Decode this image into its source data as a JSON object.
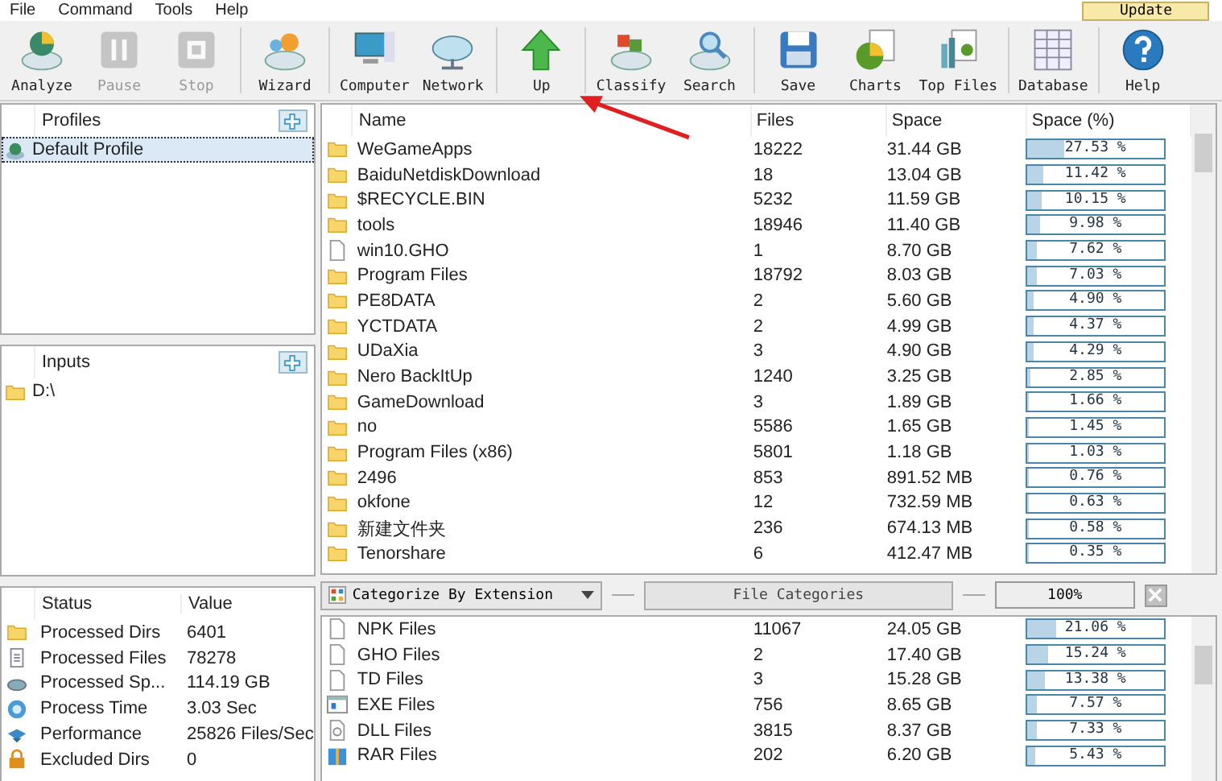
{
  "menu": [
    "File",
    "Command",
    "Tools",
    "Help"
  ],
  "update_button": "Update",
  "toolbar": [
    [
      {
        "label": "Analyze",
        "disabled": false
      },
      {
        "label": "Pause",
        "disabled": true
      },
      {
        "label": "Stop",
        "disabled": true
      }
    ],
    [
      {
        "label": "Wizard",
        "disabled": false
      }
    ],
    [
      {
        "label": "Computer",
        "disabled": false
      },
      {
        "label": "Network",
        "disabled": false
      }
    ],
    [
      {
        "label": "Up",
        "disabled": false
      }
    ],
    [
      {
        "label": "Classify",
        "disabled": false
      },
      {
        "label": "Search",
        "disabled": false
      }
    ],
    [
      {
        "label": "Save",
        "disabled": false
      },
      {
        "label": "Charts",
        "disabled": false
      },
      {
        "label": "Top Files",
        "disabled": false
      }
    ],
    [
      {
        "label": "Database",
        "disabled": false
      }
    ],
    [
      {
        "label": "Help",
        "disabled": false
      }
    ]
  ],
  "profiles": {
    "title": "Profiles",
    "items": [
      {
        "label": "Default Profile",
        "selected": true
      }
    ]
  },
  "inputs": {
    "title": "Inputs",
    "items": [
      {
        "label": "D:\\",
        "selected": false
      }
    ]
  },
  "status": {
    "columns": [
      "Status",
      "Value"
    ],
    "rows": [
      {
        "label": "Processed Dirs",
        "value": "6401"
      },
      {
        "label": "Processed Files",
        "value": "78278"
      },
      {
        "label": "Processed Sp...",
        "value": "114.19 GB"
      },
      {
        "label": "Process Time",
        "value": "3.03 Sec"
      },
      {
        "label": "Performance",
        "value": "25826 Files/Sec"
      },
      {
        "label": "Excluded Dirs",
        "value": "0"
      }
    ]
  },
  "table": {
    "columns": [
      "Name",
      "Files",
      "Space",
      "Space (%)"
    ],
    "rows": [
      {
        "kind": "folder",
        "name": "WeGameApps",
        "files": "18222",
        "space": "31.44 GB",
        "percent": "27.53 %",
        "level": 0.2753
      },
      {
        "kind": "folder",
        "name": "BaiduNetdiskDownload",
        "files": "18",
        "space": "13.04 GB",
        "percent": "11.42 %",
        "level": 0.1142
      },
      {
        "kind": "folder",
        "name": "$RECYCLE.BIN",
        "files": "5232",
        "space": "11.59 GB",
        "percent": "10.15 %",
        "level": 0.1015
      },
      {
        "kind": "folder",
        "name": "tools",
        "files": "18946",
        "space": "11.40 GB",
        "percent": "9.98 %",
        "level": 0.0998
      },
      {
        "kind": "file",
        "name": "win10.GHO",
        "files": "1",
        "space": "8.70 GB",
        "percent": "7.62 %",
        "level": 0.0762
      },
      {
        "kind": "folder",
        "name": "Program Files",
        "files": "18792",
        "space": "8.03 GB",
        "percent": "7.03 %",
        "level": 0.0703
      },
      {
        "kind": "folder",
        "name": "PE8DATA",
        "files": "2",
        "space": "5.60 GB",
        "percent": "4.90 %",
        "level": 0.049
      },
      {
        "kind": "folder",
        "name": "YCTDATA",
        "files": "2",
        "space": "4.99 GB",
        "percent": "4.37 %",
        "level": 0.0437
      },
      {
        "kind": "folder",
        "name": "UDaXia",
        "files": "3",
        "space": "4.90 GB",
        "percent": "4.29 %",
        "level": 0.0429
      },
      {
        "kind": "folder",
        "name": "Nero BackItUp",
        "files": "1240",
        "space": "3.25 GB",
        "percent": "2.85 %",
        "level": 0.0285
      },
      {
        "kind": "folder",
        "name": "GameDownload",
        "files": "3",
        "space": "1.89 GB",
        "percent": "1.66 %",
        "level": 0.0166
      },
      {
        "kind": "folder",
        "name": "no",
        "files": "5586",
        "space": "1.65 GB",
        "percent": "1.45 %",
        "level": 0.0145
      },
      {
        "kind": "folder",
        "name": "Program Files (x86)",
        "files": "5801",
        "space": "1.18 GB",
        "percent": "1.03 %",
        "level": 0.0103
      },
      {
        "kind": "folder",
        "name": "2496",
        "files": "853",
        "space": "891.52 MB",
        "percent": "0.76 %",
        "level": 0.0076
      },
      {
        "kind": "folder",
        "name": "okfone",
        "files": "12",
        "space": "732.59 MB",
        "percent": "0.63 %",
        "level": 0.0063
      },
      {
        "kind": "folder",
        "name": "新建文件夹",
        "files": "236",
        "space": "674.13 MB",
        "percent": "0.58 %",
        "level": 0.0058
      },
      {
        "kind": "folder",
        "name": "Tenorshare",
        "files": "6",
        "space": "412.47 MB",
        "percent": "0.35 %",
        "level": 0.0035
      }
    ]
  },
  "category_bar": {
    "mode": "Categorize By Extension",
    "title": "File Categories",
    "zoom": "100%"
  },
  "categories": [
    {
      "kind": "file",
      "name": "NPK Files",
      "files": "11067",
      "space": "24.05 GB",
      "percent": "21.06 %",
      "level": 0.2106
    },
    {
      "kind": "file",
      "name": "GHO Files",
      "files": "2",
      "space": "17.40 GB",
      "percent": "15.24 %",
      "level": 0.1524
    },
    {
      "kind": "file",
      "name": "TD Files",
      "files": "3",
      "space": "15.28 GB",
      "percent": "13.38 %",
      "level": 0.1338
    },
    {
      "kind": "exe",
      "name": "EXE Files",
      "files": "756",
      "space": "8.65 GB",
      "percent": "7.57 %",
      "level": 0.0757
    },
    {
      "kind": "dll",
      "name": "DLL Files",
      "files": "3815",
      "space": "8.37 GB",
      "percent": "7.33 %",
      "level": 0.0733
    },
    {
      "kind": "rar",
      "name": "RAR Files",
      "files": "202",
      "space": "6.20 GB",
      "percent": "5.43 %",
      "level": 0.0543
    }
  ]
}
